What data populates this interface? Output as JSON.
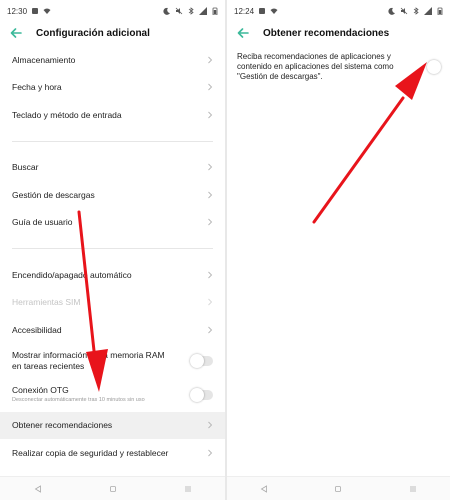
{
  "left": {
    "status": {
      "time": "12:30"
    },
    "title": "Configuración adicional",
    "items": [
      {
        "label": "Almacenamiento"
      },
      {
        "label": "Fecha y hora"
      },
      {
        "label": "Teclado y método de entrada"
      },
      {
        "label": "Buscar"
      },
      {
        "label": "Gestión de descargas"
      },
      {
        "label": "Guía de usuario"
      },
      {
        "label": "Encendido/apagado automático"
      },
      {
        "label": "Herramientas SIM"
      },
      {
        "label": "Accesibilidad"
      },
      {
        "label": "Mostrar información de la memoria RAM en tareas recientes"
      },
      {
        "label": "Conexión OTG",
        "sub": "Desconectar automáticamente tras 10 minutos sin uso"
      },
      {
        "label": "Obtener recomendaciones"
      },
      {
        "label": "Realizar copia de seguridad y restablecer"
      }
    ]
  },
  "right": {
    "status": {
      "time": "12:24"
    },
    "title": "Obtener recomendaciones",
    "description": "Reciba recomendaciones de aplicaciones y contenido en aplicaciones del sistema como \"Gestión de descargas\".",
    "toggle_on": true
  },
  "colors": {
    "accent": "#3bb99a",
    "arrow": "#e8141b"
  }
}
